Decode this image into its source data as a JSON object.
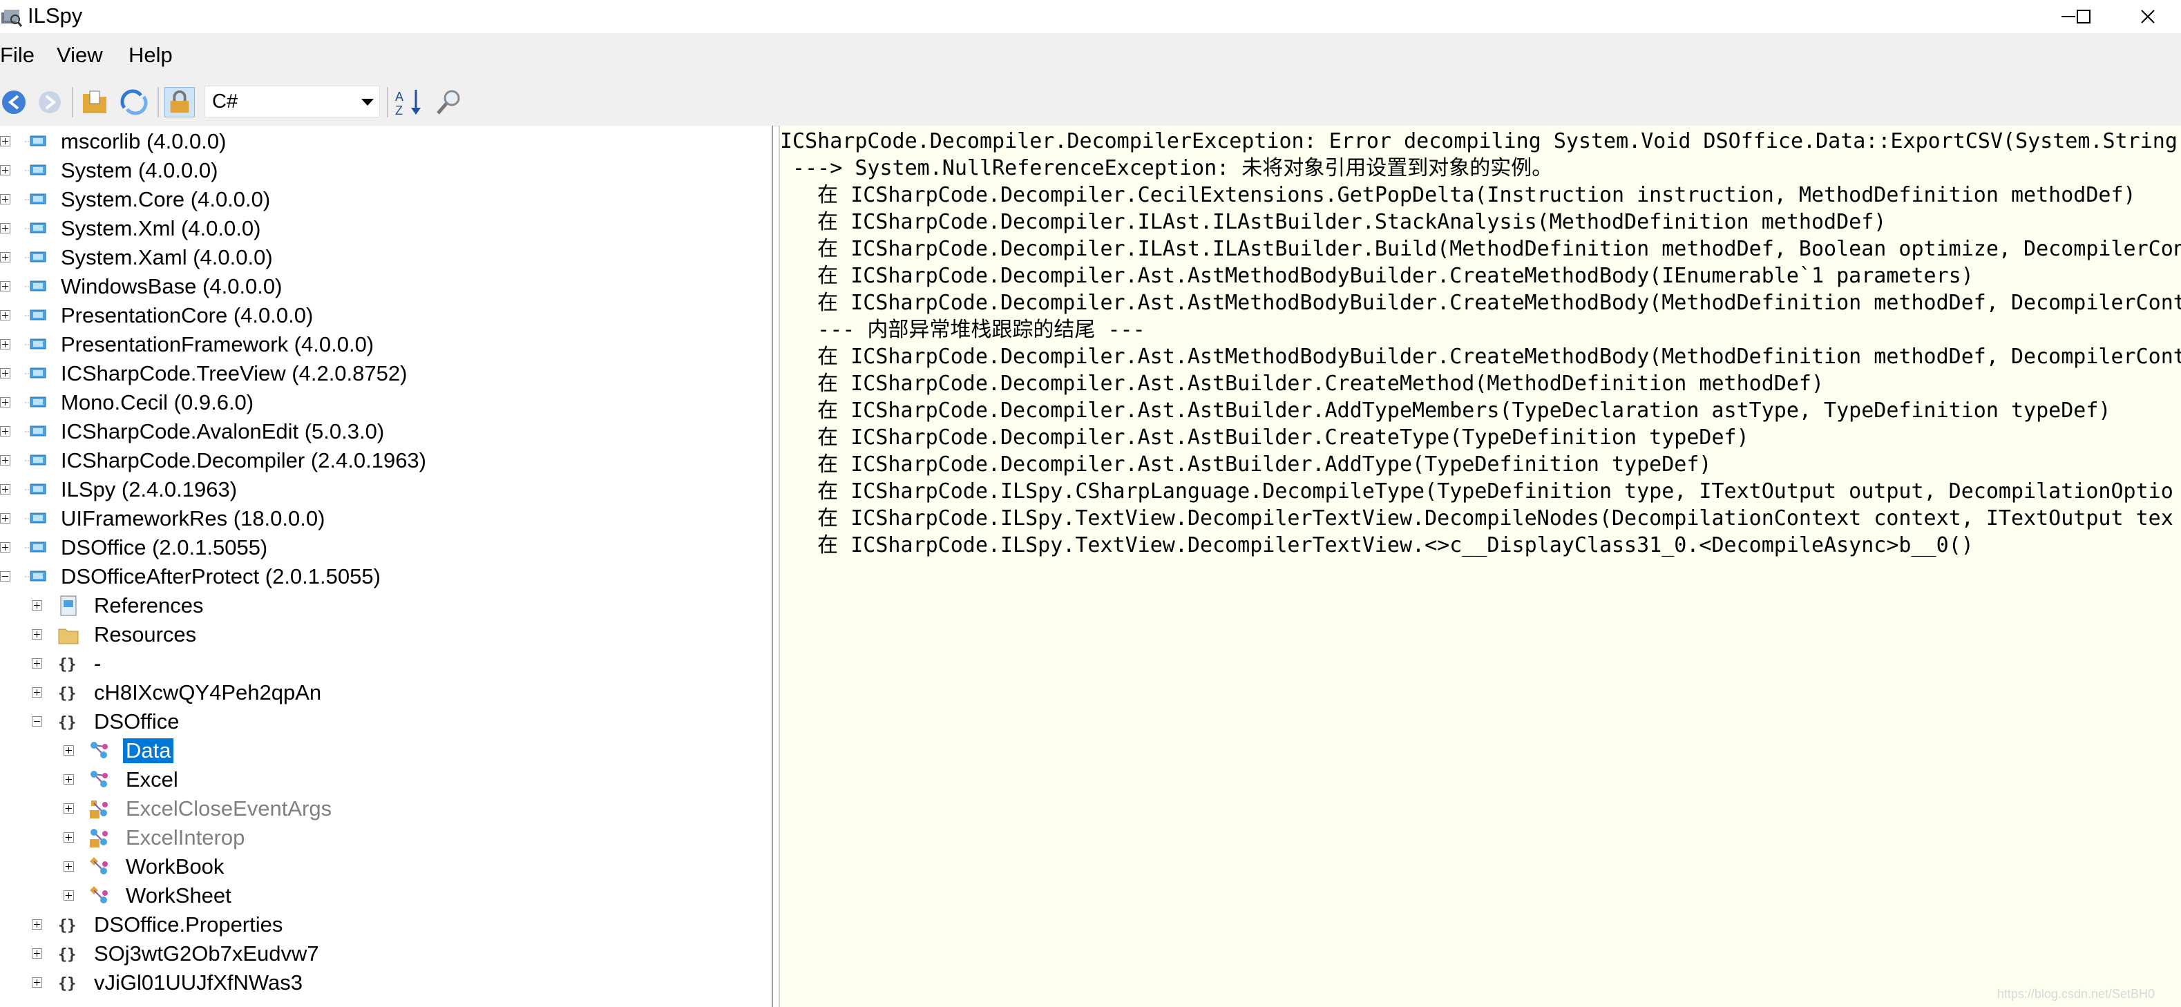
{
  "window": {
    "title": "ILSpy",
    "controls": [
      "minimize",
      "maximize",
      "close"
    ]
  },
  "menu": [
    "File",
    "View",
    "Help"
  ],
  "toolbar": {
    "icons": [
      "back-icon",
      "forward-icon",
      "open-file-icon",
      "reload-icon",
      "show-private-icon",
      "sort-icon",
      "search-icon"
    ],
    "language": "C#"
  },
  "tree": {
    "assemblies": [
      "mscorlib (4.0.0.0)",
      "System (4.0.0.0)",
      "System.Core (4.0.0.0)",
      "System.Xml (4.0.0.0)",
      "System.Xaml (4.0.0.0)",
      "WindowsBase (4.0.0.0)",
      "PresentationCore (4.0.0.0)",
      "PresentationFramework (4.0.0.0)",
      "ICSharpCode.TreeView (4.2.0.8752)",
      "Mono.Cecil (0.9.6.0)",
      "ICSharpCode.AvalonEdit (5.0.3.0)",
      "ICSharpCode.Decompiler (2.4.0.1963)",
      "ILSpy (2.4.0.1963)",
      "UIFrameworkRes (18.0.0.0)",
      "DSOffice (2.0.1.5055)",
      "DSOfficeAfterProtect (2.0.1.5055)"
    ],
    "children": {
      "references": "References",
      "resources": "Resources",
      "ns_dash": "-",
      "ns_obf1": "cH8IXcwQY4Peh2qpAn",
      "ns_dsoffice": "DSOffice",
      "types": {
        "data": "Data",
        "excel": "Excel",
        "excel_close_event_args": "ExcelCloseEventArgs",
        "excel_interop": "ExcelInterop",
        "workbook": "WorkBook",
        "worksheet": "WorkSheet"
      },
      "ns_properties": "DSOffice.Properties",
      "ns_obf2": "SOj3wtG2Ob7xEudvw7",
      "ns_obf3": "vJiGl01UUJfXfNWas3"
    },
    "selected": "Data"
  },
  "output": {
    "lines": [
      "ICSharpCode.Decompiler.DecompilerException: Error decompiling System.Void DSOffice.Data::ExportCSV(System.String",
      " ---> System.NullReferenceException: 未将对象引用设置到对象的实例。",
      "   在 ICSharpCode.Decompiler.CecilExtensions.GetPopDelta(Instruction instruction, MethodDefinition methodDef)",
      "   在 ICSharpCode.Decompiler.ILAst.ILAstBuilder.StackAnalysis(MethodDefinition methodDef)",
      "   在 ICSharpCode.Decompiler.ILAst.ILAstBuilder.Build(MethodDefinition methodDef, Boolean optimize, DecompilerCon",
      "   在 ICSharpCode.Decompiler.Ast.AstMethodBodyBuilder.CreateMethodBody(IEnumerable`1 parameters)",
      "   在 ICSharpCode.Decompiler.Ast.AstMethodBodyBuilder.CreateMethodBody(MethodDefinition methodDef, DecompilerCont",
      "   --- 内部异常堆栈跟踪的结尾 ---",
      "   在 ICSharpCode.Decompiler.Ast.AstMethodBodyBuilder.CreateMethodBody(MethodDefinition methodDef, DecompilerCont",
      "   在 ICSharpCode.Decompiler.Ast.AstBuilder.CreateMethod(MethodDefinition methodDef)",
      "   在 ICSharpCode.Decompiler.Ast.AstBuilder.AddTypeMembers(TypeDeclaration astType, TypeDefinition typeDef)",
      "   在 ICSharpCode.Decompiler.Ast.AstBuilder.CreateType(TypeDefinition typeDef)",
      "   在 ICSharpCode.Decompiler.Ast.AstBuilder.AddType(TypeDefinition typeDef)",
      "   在 ICSharpCode.ILSpy.CSharpLanguage.DecompileType(TypeDefinition type, ITextOutput output, DecompilationOptio",
      "   在 ICSharpCode.ILSpy.TextView.DecompilerTextView.DecompileNodes(DecompilationContext context, ITextOutput tex",
      "   在 ICSharpCode.ILSpy.TextView.DecompilerTextView.<>c__DisplayClass31_0.<DecompileAsync>b__0()"
    ],
    "watermark": "https://blog.csdn.net/SetBH0"
  },
  "colors": {
    "selection": "#0078d7",
    "output_background": "#fffff0",
    "chrome": "#f0f0f0",
    "dim_text": "#808080"
  }
}
